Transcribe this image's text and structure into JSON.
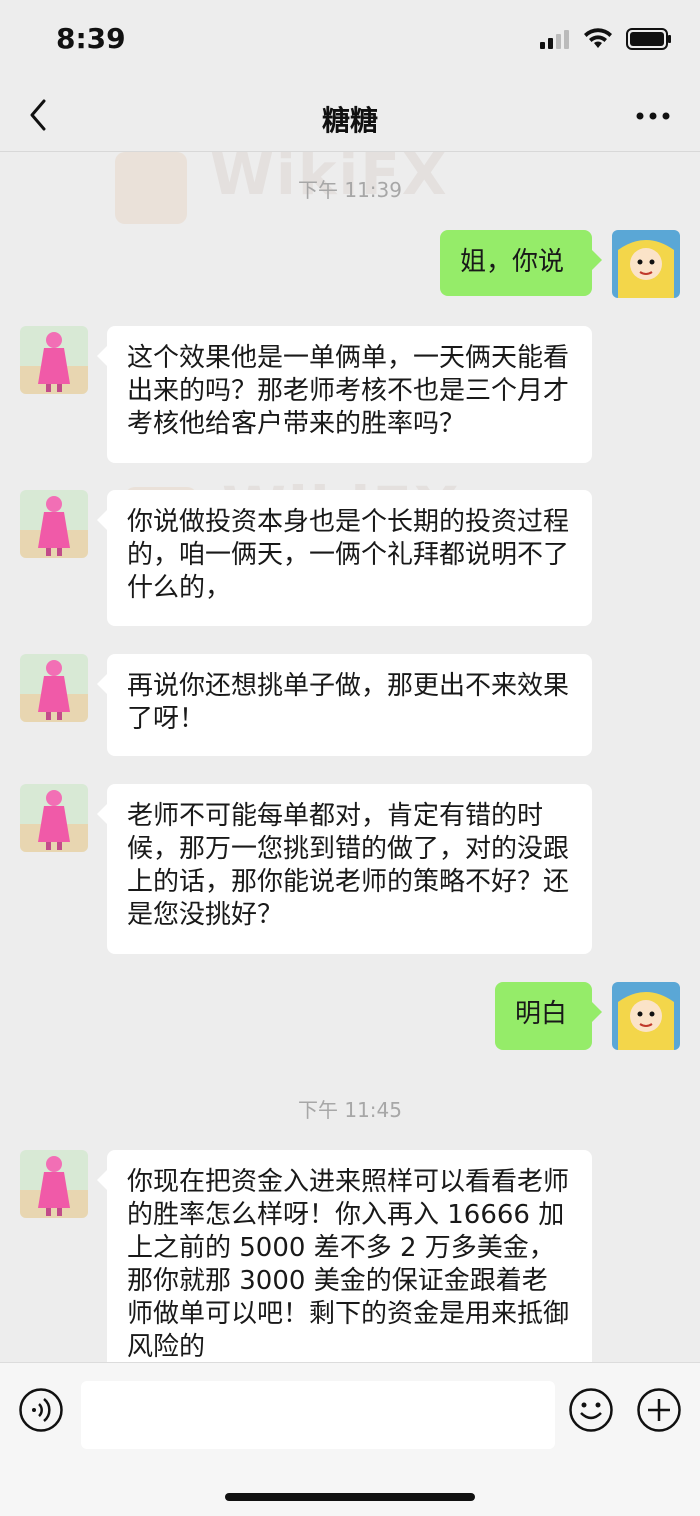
{
  "status_bar": {
    "time": "8:39"
  },
  "nav": {
    "title": "糖糖"
  },
  "watermark": "WikiFX",
  "messages": {
    "ts1": "下午 11:39",
    "m1": "姐，你说",
    "m2": "这个效果他是一单俩单，一天俩天能看出来的吗？那老师考核不也是三个月才考核他给客户带来的胜率吗？",
    "m3": "你说做投资本身也是个长期的投资过程的，咱一俩天，一俩个礼拜都说明不了什么的，",
    "m4": "再说你还想挑单子做，那更出不来效果了呀！",
    "m5": "老师不可能每单都对，肯定有错的时候，那万一您挑到错的做了，对的没跟上的话，那你能说老师的策略不好？还是您没挑好？",
    "m6": "明白",
    "ts2": "下午 11:45",
    "m7": "你现在把资金入进来照样可以看看老师的胜率怎么样呀！你入再入 16666 加上之前的 5000 差不多 2 万多美金，那你就那 3000 美金的保证金跟着老师做单可以吧！剩下的资金是用来抵御风险的"
  },
  "input": {
    "value": ""
  },
  "colors": {
    "background": "#ededed",
    "outgoing_bubble": "#95ec69",
    "incoming_bubble": "#ffffff"
  },
  "icons": [
    "back-chevron-icon",
    "more-dots-icon",
    "voice-icon",
    "emoji-icon",
    "plus-icon",
    "signal-icon",
    "wifi-icon",
    "battery-icon"
  ]
}
